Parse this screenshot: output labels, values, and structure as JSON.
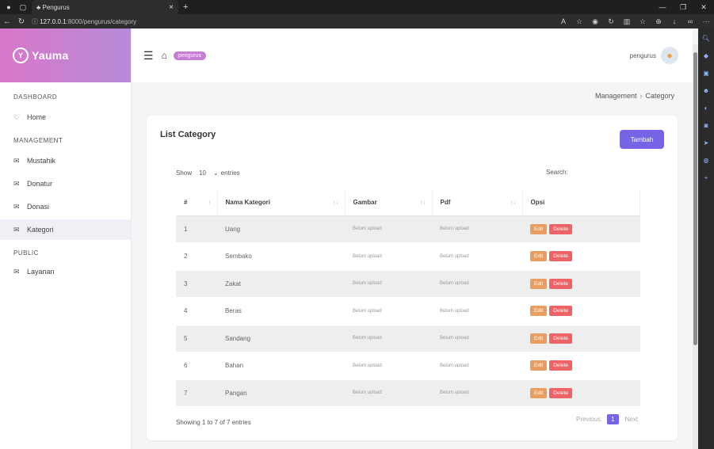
{
  "browser": {
    "tab_title": "Pengurus",
    "url_host": "127.0.0.1",
    "url_path": ":8000/pengurus/category"
  },
  "sidebar": {
    "brand": "Yauma",
    "sections": [
      {
        "title": "DASHBOARD",
        "items": [
          {
            "label": "Home",
            "icon": "lightbulb-icon"
          }
        ]
      },
      {
        "title": "MANAGEMENT",
        "items": [
          {
            "label": "Mustahik",
            "icon": "mail-icon"
          },
          {
            "label": "Donatur",
            "icon": "mail-icon"
          },
          {
            "label": "Donasi",
            "icon": "mail-icon"
          },
          {
            "label": "Kategori",
            "icon": "mail-icon",
            "active": true
          }
        ]
      },
      {
        "title": "PUBLIC",
        "items": [
          {
            "label": "Layanan",
            "icon": "mail-icon"
          }
        ]
      }
    ]
  },
  "topbar": {
    "role_badge": "pengurus",
    "user_name": "pengurus"
  },
  "breadcrumb": {
    "parent": "Management",
    "current": "Category"
  },
  "card": {
    "title": "List Category",
    "add_label": "Tambah",
    "show_label": "Show",
    "entries_value": "10",
    "entries_label": "entries",
    "search_label": "Search:",
    "columns": [
      "#",
      "Nama Kategori",
      "Gambar",
      "Pdf",
      "Opsi"
    ],
    "rows": [
      {
        "no": "1",
        "name": "Uang",
        "gambar": "Belum upload",
        "pdf": "Belum upload"
      },
      {
        "no": "2",
        "name": "Sembako",
        "gambar": "Belum upload",
        "pdf": "Belum upload"
      },
      {
        "no": "3",
        "name": "Zakat",
        "gambar": "Belum upload",
        "pdf": "Belum upload"
      },
      {
        "no": "4",
        "name": "Beras",
        "gambar": "Belum upload",
        "pdf": "Belum upload"
      },
      {
        "no": "5",
        "name": "Sandang",
        "gambar": "Belum upload",
        "pdf": "Belum upload"
      },
      {
        "no": "6",
        "name": "Bahan",
        "gambar": "Belum upload",
        "pdf": "Belum upload"
      },
      {
        "no": "7",
        "name": "Pangan",
        "gambar": "Belum upload",
        "pdf": "Belum upload"
      }
    ],
    "edit_label": "Edit",
    "delete_label": "Delete",
    "info": "Showing 1 to 7 of 7 entries",
    "pager": {
      "previous": "Previous",
      "current": "1",
      "next": "Next"
    }
  },
  "colors": {
    "accent": "#7565e4",
    "brand_gradient_start": "#d977c9",
    "edit": "#e99e60",
    "delete": "#ee6466"
  }
}
